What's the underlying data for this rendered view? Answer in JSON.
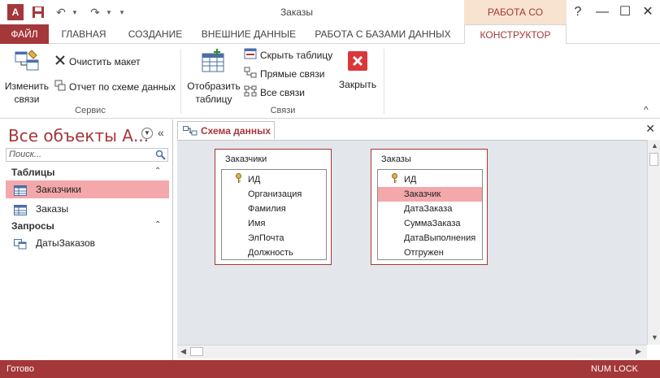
{
  "app": {
    "icon_text": "A",
    "window_title": "Заказы",
    "context_header": "РАБОТА СО СВЯЗЯМИ",
    "help": "?",
    "minimize": "—",
    "maximize": "☐",
    "close": "✕",
    "qa_undo": "↶",
    "qa_redo": "↷",
    "qa_more": "▾"
  },
  "tabs": [
    {
      "label": "ФАЙЛ"
    },
    {
      "label": "ГЛАВНАЯ"
    },
    {
      "label": "СОЗДАНИЕ"
    },
    {
      "label": "ВНЕШНИЕ ДАННЫЕ"
    },
    {
      "label": "РАБОТА С БАЗАМИ ДАННЫХ"
    },
    {
      "label": "КОНСТРУКТОР"
    }
  ],
  "ribbon": {
    "edit_relations": [
      "Изменить",
      "связи"
    ],
    "clear_layout": "Очистить макет",
    "report": "Отчет по схеме данных",
    "group_service": "Сервис",
    "show_table": [
      "Отобразить",
      "таблицу"
    ],
    "hide_table": "Скрыть таблицу",
    "direct_links": "Прямые связи",
    "all_links": "Все связи",
    "close": "Закрыть",
    "group_links": "Связи",
    "collapse": "^"
  },
  "nav": {
    "title": "Все объекты А...",
    "collapse": "«",
    "search_placeholder": "Поиск...",
    "sections": [
      {
        "label": "Таблицы",
        "chevron": "⌃"
      },
      {
        "label": "Запросы",
        "chevron": "⌃"
      }
    ],
    "tables": [
      {
        "label": "Заказчики"
      },
      {
        "label": "Заказы"
      }
    ],
    "queries": [
      {
        "label": "ДатыЗаказов"
      }
    ]
  },
  "document": {
    "tab_label": "Схема данных",
    "close": "✕"
  },
  "diagram": {
    "tables": [
      {
        "title": "Заказчики",
        "fields": [
          "ИД",
          "Организация",
          "Фамилия",
          "Имя",
          "ЭлПочта",
          "Должность"
        ]
      },
      {
        "title": "Заказы",
        "fields": [
          "ИД",
          "Заказчик",
          "ДатаЗаказа",
          "СуммаЗаказа",
          "ДатаВыполнения",
          "Отгружен"
        ]
      }
    ]
  },
  "status": {
    "left": "Готово",
    "right": "NUM LOCK"
  }
}
